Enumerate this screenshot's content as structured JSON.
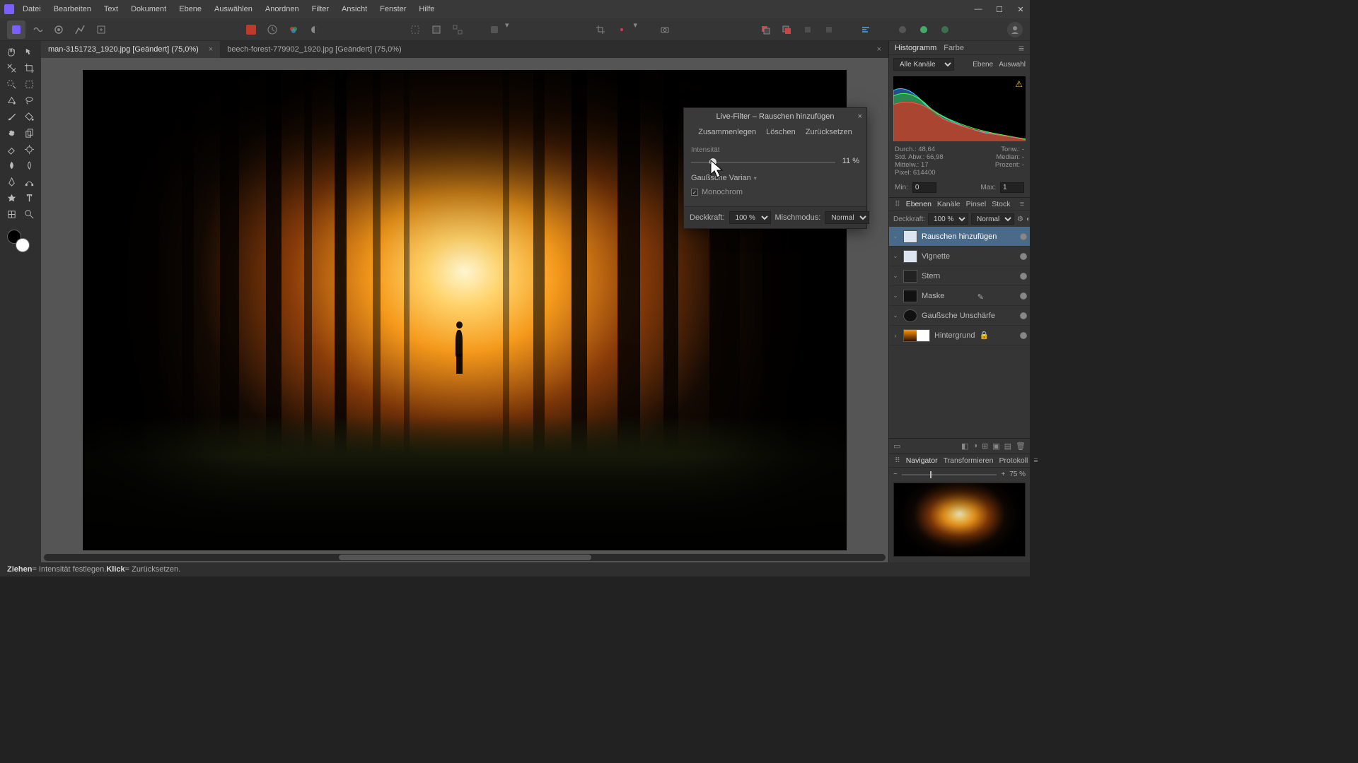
{
  "menu": [
    "Datei",
    "Bearbeiten",
    "Text",
    "Dokument",
    "Ebene",
    "Auswählen",
    "Anordnen",
    "Filter",
    "Ansicht",
    "Fenster",
    "Hilfe"
  ],
  "tabs": [
    {
      "label": "man-3151723_1920.jpg [Geändert] (75,0%)",
      "active": true
    },
    {
      "label": "beech-forest-779902_1920.jpg [Geändert] (75,0%)",
      "active": false
    }
  ],
  "dialog": {
    "title": "Live-Filter – Rauschen hinzufügen",
    "actions": [
      "Zusammenlegen",
      "Löschen",
      "Zurücksetzen"
    ],
    "intensity_label": "Intensität",
    "intensity_value": "11 %",
    "distribution": "Gaußsche Varian",
    "mono_label": "Monochrom",
    "opacity_label": "Deckkraft:",
    "opacity_value": "100 %",
    "blend_label": "Mischmodus:",
    "blend_value": "Normal"
  },
  "histogram_tabs": [
    "Histogramm",
    "Farbe"
  ],
  "hist_channels": "Alle Kanäle",
  "hist_scope": [
    "Ebene",
    "Auswahl"
  ],
  "stats": {
    "durch": "Durch.: 48,64",
    "tonwert": "Tonw.: -",
    "stdabw": "Std. Abw.: 66,98",
    "median": "Median: -",
    "mittelw": "Mittelw.: 17",
    "prozent": "Prozent: -",
    "pixel": "Pixel: 614400",
    "min_label": "Min:",
    "min": "0",
    "max_label": "Max:",
    "max": "1"
  },
  "layer_tabs": [
    "Ebenen",
    "Kanäle",
    "Pinsel",
    "Stock"
  ],
  "layer_hdr": {
    "opacity_label": "Deckkraft:",
    "opacity": "100 %",
    "blend": "Normal"
  },
  "layers": [
    {
      "name": "Rauschen hinzufügen",
      "sel": true,
      "ind": "⌄"
    },
    {
      "name": "Vignette",
      "ind": "⌄"
    },
    {
      "name": "Stern",
      "ind": "⌄"
    },
    {
      "name": "Maske",
      "ind": "⌄",
      "pen": true
    },
    {
      "name": "Gaußsche Unschärfe",
      "ind": "⌄"
    },
    {
      "name": "Hintergrund",
      "ind": "›",
      "dual": true,
      "lock": true
    }
  ],
  "nav_tabs": [
    "Navigator",
    "Transformieren",
    "Protokoll"
  ],
  "nav_zoom": "75 %",
  "status": {
    "drag": "Ziehen",
    "drag_txt": " = Intensität festlegen. ",
    "click": "Klick",
    "click_txt": " = Zurücksetzen."
  }
}
